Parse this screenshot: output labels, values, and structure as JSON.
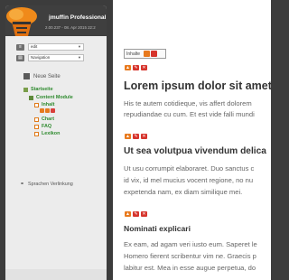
{
  "brand": {
    "name": "jmuffin Professional",
    "version": "2.00.237 - 08. Apr 2015 22:2"
  },
  "toolbar": {
    "lang_select": {
      "icon": "en-flag-icon",
      "value": "edit"
    },
    "nav_select": {
      "value": "Navigation"
    }
  },
  "new_page": {
    "label": "Neue Seite"
  },
  "tree": {
    "start": "Startseite",
    "content": "Content Module",
    "items": [
      "Inhalt",
      "Chart",
      "FAQ",
      "Lexikon"
    ]
  },
  "links": {
    "label": "Sprachen Verlinkung"
  },
  "content": {
    "inhalte_label": "Inhalte",
    "h1": "Lorem ipsum dolor sit amet",
    "p1": [
      "His te autem cotidieque, vis affert dolorem",
      "repudiandae cu cum. Et est vide falli mundi"
    ],
    "h2": "Ut sea volutpua vivendum delica",
    "p2": [
      "Ut usu corrumpit elaboraret. Duo sanctus c",
      "id vix, id mel mucius vocent regione, no nu",
      "expetenda nam, ex diam similique mei."
    ],
    "h3": "Nominati explicari",
    "p3": [
      "Ex eam, ad agam veri iusto eum. Saperet le",
      "Homero fierent scribentur vim ne. Graecis p",
      "labitur est. Mea in esse augue perpetua, do"
    ]
  },
  "colors": {
    "orange": "#e87a1e",
    "red": "#d6342c",
    "green": "#2e8a2e",
    "panel_dark": "#3f3f3f"
  }
}
